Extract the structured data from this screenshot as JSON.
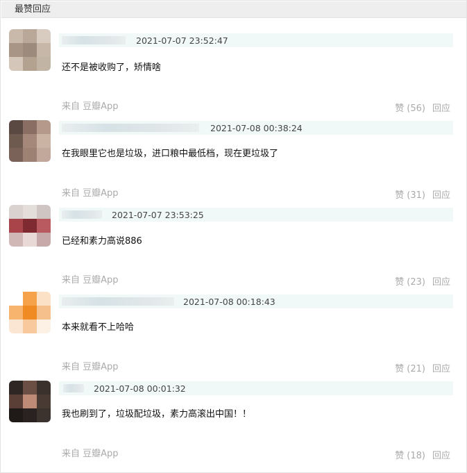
{
  "section": {
    "title": "最赞回应"
  },
  "comments": [
    {
      "timestamp": "2021-07-07 23:52:47",
      "content": "还不是被收购了，矫情啥",
      "source": "来自 豆瓣App",
      "like_label": "赞",
      "like_count": "(56)",
      "reply_label": "回应",
      "avatar_colors": [
        "#c9b9aa",
        "#b9a797",
        "#d8ccc0",
        "#a89586",
        "#9c8a7c",
        "#c7b7a8",
        "#d4c6b9",
        "#b4a291",
        "#c2b4a5"
      ]
    },
    {
      "timestamp": "2021-07-08 00:38:24",
      "content": "在我眼里它也是垃圾，进口粮中最低档，现在更垃圾了",
      "source": "来自 豆瓣App",
      "like_label": "赞",
      "like_count": "(31)",
      "reply_label": "回应",
      "avatar_colors": [
        "#5a4842",
        "#8b6e63",
        "#b59a8c",
        "#6f5a50",
        "#a5887a",
        "#cbb3a4",
        "#7a6259",
        "#9d8274",
        "#c1a89a"
      ]
    },
    {
      "timestamp": "2021-07-07 23:53:25",
      "content": "已经和素力高说886",
      "source": "来自 豆瓣App",
      "like_label": "赞",
      "like_count": "(23)",
      "reply_label": "回应",
      "avatar_colors": [
        "#d9d2cf",
        "#e4dedb",
        "#cfc6c3",
        "#a8444a",
        "#7f2a31",
        "#b85a5f",
        "#d0b8b7",
        "#e8d9d7",
        "#c8a9aa"
      ]
    },
    {
      "timestamp": "2021-07-08 00:18:43",
      "content": "本来就看不上哈哈",
      "source": "来自 豆瓣App",
      "like_label": "赞",
      "like_count": "(21)",
      "reply_label": "回应",
      "avatar_colors": [
        "#ffffff",
        "#f6a24a",
        "#fbe1c6",
        "#f7b46e",
        "#f08a22",
        "#f5c08c",
        "#fbe6d3",
        "#f8c99c",
        "#fdf1e6"
      ]
    },
    {
      "timestamp": "2021-07-08 00:01:32",
      "content": "我也刷到了，垃圾配垃圾，素力高滚出中国！！",
      "source": "来自 豆瓣App",
      "like_label": "赞",
      "like_count": "(18)",
      "reply_label": "回应",
      "avatar_colors": [
        "#2e2623",
        "#6b4f45",
        "#3a302c",
        "#5a3f36",
        "#c08b76",
        "#4a3a34",
        "#1f1a18",
        "#2a2220",
        "#3c322e"
      ]
    }
  ]
}
